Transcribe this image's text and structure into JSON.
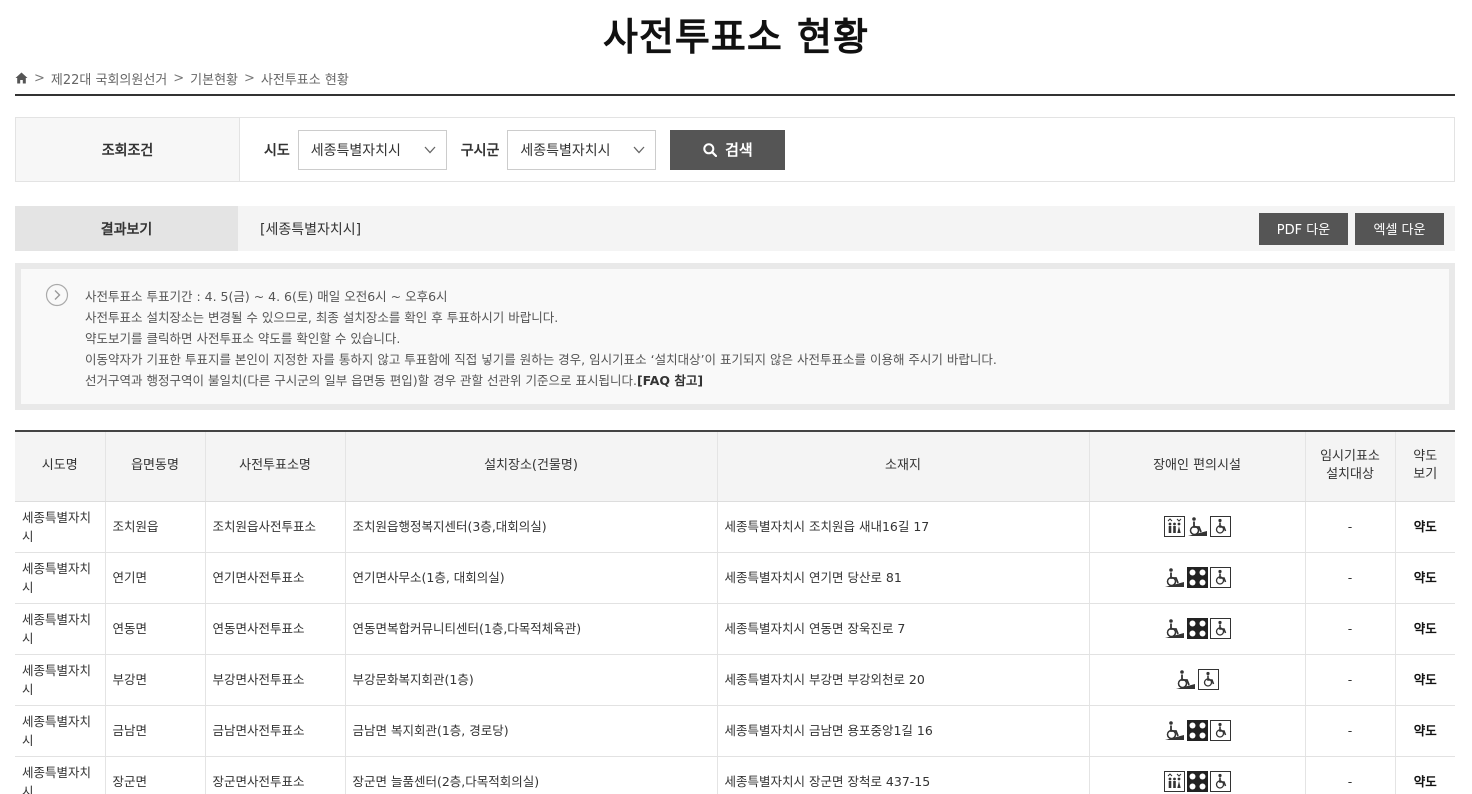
{
  "page_title": "사전투표소 현황",
  "breadcrumb": {
    "home_icon": "home-icon",
    "items": [
      "제22대 국회의원선거",
      "기본현황",
      "사전투표소 현황"
    ]
  },
  "search": {
    "label": "조회조건",
    "sido_label": "시도",
    "sido_value": "세종특별자치시",
    "sigungu_label": "구시군",
    "sigungu_value": "세종특별자치시",
    "button_label": "검색"
  },
  "result": {
    "label": "결과보기",
    "region": "[세종특별자치시]",
    "pdf_button": "PDF 다운",
    "excel_button": "엑셀 다운"
  },
  "notice": {
    "lines": [
      "사전투표소 투표기간 : 4. 5(금) ~ 4. 6(토) 매일 오전6시 ~ 오후6시",
      "사전투표소 설치장소는 변경될 수 있으므로, 최종 설치장소를 확인 후 투표하시기 바랍니다.",
      "약도보기를 클릭하면 사전투표소 약도를 확인할 수 있습니다.",
      "이동약자가 기표한 투표지를 본인이 지정한 자를 통하지 않고 투표함에 직접 넣기를 원하는 경우, 임시기표소 ‘설치대상’이 표기되지 않은 사전투표소를 이용해 주시기 바랍니다."
    ],
    "last_line": "선거구역과 행정구역이 불일치(다른 구시군의 일부 읍면동 편입)할 경우 관할 선관위 기준으로 표시됩니다.",
    "faq_link": "[FAQ 참고]"
  },
  "table": {
    "headers": [
      "시도명",
      "읍면동명",
      "사전투표소명",
      "설치장소(건물명)",
      "소재지",
      "장애인 편의시설",
      "임시기표소 설치대상",
      "약도 보기"
    ],
    "rows": [
      {
        "sido": "세종특별자치시",
        "emd": "조치원읍",
        "name": "조치원읍사전투표소",
        "place": "조치원읍행정복지센터(3층,대회의실)",
        "address": "세종특별자치시 조치원읍 새내16길 17",
        "facilities": [
          "elevator-icon",
          "wheelchair-ramp-icon",
          "accessible-toilet-icon"
        ],
        "temp_booth": "-",
        "map": "약도"
      },
      {
        "sido": "세종특별자치시",
        "emd": "연기면",
        "name": "연기면사전투표소",
        "place": "연기면사무소(1층, 대회의실)",
        "address": "세종특별자치시 연기면 당산로 81",
        "facilities": [
          "wheelchair-ramp-icon",
          "braille-block-icon",
          "accessible-toilet-icon"
        ],
        "temp_booth": "-",
        "map": "약도"
      },
      {
        "sido": "세종특별자치시",
        "emd": "연동면",
        "name": "연동면사전투표소",
        "place": "연동면복합커뮤니티센터(1층,다목적체육관)",
        "address": "세종특별자치시 연동면 장욱진로 7",
        "facilities": [
          "wheelchair-ramp-icon",
          "braille-block-icon",
          "accessible-toilet-icon"
        ],
        "temp_booth": "-",
        "map": "약도"
      },
      {
        "sido": "세종특별자치시",
        "emd": "부강면",
        "name": "부강면사전투표소",
        "place": "부강문화복지회관(1층)",
        "address": "세종특별자치시 부강면 부강외천로 20",
        "facilities": [
          "wheelchair-ramp-icon",
          "accessible-toilet-icon"
        ],
        "temp_booth": "-",
        "map": "약도"
      },
      {
        "sido": "세종특별자치시",
        "emd": "금남면",
        "name": "금남면사전투표소",
        "place": "금남면 복지회관(1층, 경로당)",
        "address": "세종특별자치시 금남면 용포중앙1길 16",
        "facilities": [
          "wheelchair-ramp-icon",
          "braille-block-icon",
          "accessible-toilet-icon"
        ],
        "temp_booth": "-",
        "map": "약도"
      },
      {
        "sido": "세종특별자치시",
        "emd": "장군면",
        "name": "장군면사전투표소",
        "place": "장군면 늘품센터(2층,다목적회의실)",
        "address": "세종특별자치시 장군면 장척로 437-15",
        "facilities": [
          "elevator-icon",
          "braille-block-icon",
          "accessible-toilet-icon"
        ],
        "temp_booth": "-",
        "map": "약도"
      }
    ]
  }
}
